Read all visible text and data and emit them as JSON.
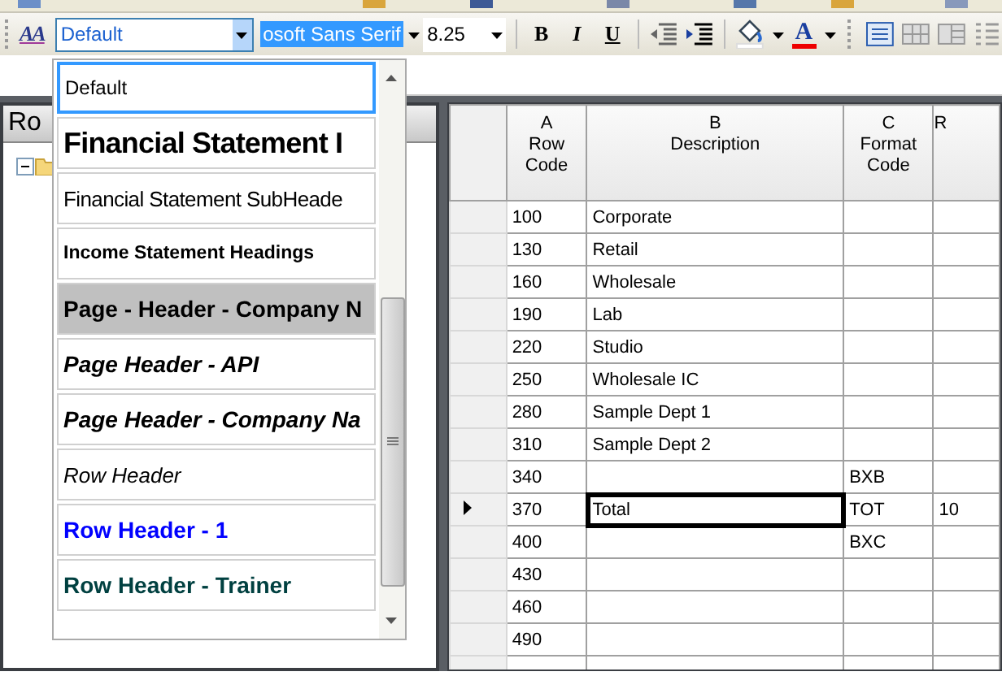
{
  "toolbar": {
    "styles_glyph": "AA",
    "style_box": {
      "value": "Default",
      "open": true
    },
    "font_box": {
      "value": "osoft Sans Serif"
    },
    "size_box": {
      "value": "8.25"
    },
    "format_buttons": [
      {
        "label": "B",
        "kind": "bold"
      },
      {
        "label": "I",
        "kind": "italic"
      },
      {
        "label": "U",
        "kind": "underline"
      }
    ],
    "font_color_glyph": "A"
  },
  "style_list": {
    "items": [
      {
        "label": "Default",
        "kind": "plain",
        "color": "#000000",
        "selected": true,
        "hover": false
      },
      {
        "label": "Financial Statement I",
        "kind": "large-bold",
        "color": "#000000",
        "selected": false,
        "hover": false
      },
      {
        "label": "Financial Statement SubHeade",
        "kind": "light",
        "color": "#000000",
        "selected": false,
        "hover": false
      },
      {
        "label": "Income Statement Headings",
        "kind": "small-bold",
        "color": "#000000",
        "selected": false,
        "hover": false
      },
      {
        "label": "Page - Header - Company N",
        "kind": "bold",
        "color": "#000000",
        "selected": false,
        "hover": true
      },
      {
        "label": "Page Header - API",
        "kind": "bold-italic",
        "color": "#000000",
        "selected": false,
        "hover": false
      },
      {
        "label": "Page Header - Company Na",
        "kind": "bold-italic",
        "color": "#000000",
        "selected": false,
        "hover": false
      },
      {
        "label": "Row Header",
        "kind": "italic",
        "color": "#000000",
        "selected": false,
        "hover": false
      },
      {
        "label": "Row Header - 1",
        "kind": "bold",
        "color": "#0000ff",
        "selected": false,
        "hover": false
      },
      {
        "label": "Row Header - Trainer",
        "kind": "bold",
        "color": "#004040",
        "selected": false,
        "hover": false
      }
    ]
  },
  "left_pane": {
    "title": "Ro"
  },
  "grid": {
    "columns": [
      {
        "letter": "A",
        "title": "Row\nCode"
      },
      {
        "letter": "B",
        "title": "Description"
      },
      {
        "letter": "C",
        "title": "Format\nCode"
      },
      {
        "title": "R"
      }
    ],
    "rows": [
      {
        "cells": [
          "100",
          "Corporate",
          "",
          ""
        ],
        "current": false
      },
      {
        "cells": [
          "130",
          "Retail",
          "",
          ""
        ],
        "current": false
      },
      {
        "cells": [
          "160",
          "Wholesale",
          "",
          ""
        ],
        "current": false
      },
      {
        "cells": [
          "190",
          "Lab",
          "",
          ""
        ],
        "current": false
      },
      {
        "cells": [
          "220",
          "Studio",
          "",
          ""
        ],
        "current": false
      },
      {
        "cells": [
          "250",
          "Wholesale IC",
          "",
          ""
        ],
        "current": false
      },
      {
        "cells": [
          "280",
          "Sample Dept 1",
          "",
          ""
        ],
        "current": false
      },
      {
        "cells": [
          "310",
          "Sample Dept 2",
          "",
          ""
        ],
        "current": false
      },
      {
        "cells": [
          "340",
          "",
          "BXB",
          ""
        ],
        "current": false
      },
      {
        "cells": [
          "370",
          "Total",
          "TOT",
          "10"
        ],
        "current": true
      },
      {
        "cells": [
          "400",
          "",
          "BXC",
          ""
        ],
        "current": false
      },
      {
        "cells": [
          "430",
          "",
          "",
          ""
        ],
        "current": false
      },
      {
        "cells": [
          "460",
          "",
          "",
          ""
        ],
        "current": false
      },
      {
        "cells": [
          "490",
          "",
          "",
          ""
        ],
        "current": false
      },
      {
        "cells": [
          "",
          "",
          "",
          ""
        ],
        "current": false
      }
    ]
  }
}
